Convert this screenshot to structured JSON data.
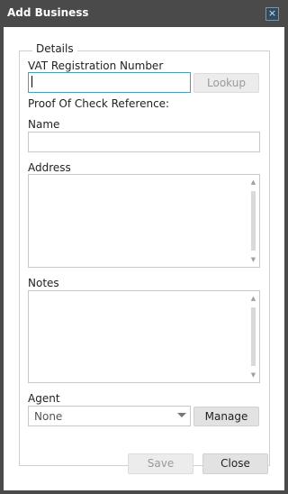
{
  "window": {
    "title": "Add Business",
    "close_glyph": "×"
  },
  "details": {
    "legend": "Details",
    "vat_label": "VAT Registration Number",
    "vat_value": "",
    "lookup_label": "Lookup",
    "proof_label": "Proof Of Check Reference:",
    "name_label": "Name",
    "name_value": "",
    "address_label": "Address",
    "address_value": "",
    "notes_label": "Notes",
    "notes_value": "",
    "agent_label": "Agent",
    "agent_selected": "None",
    "manage_label": "Manage"
  },
  "footer": {
    "save_label": "Save",
    "close_label": "Close"
  }
}
